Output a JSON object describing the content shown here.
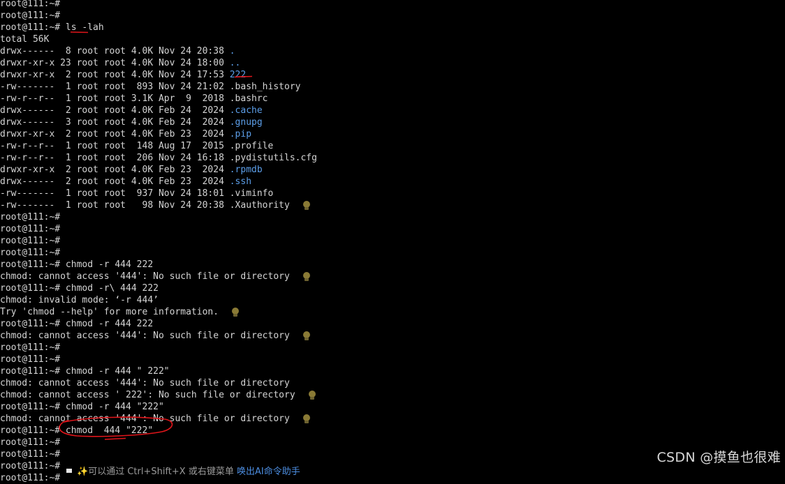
{
  "terminal": {
    "lines": [
      {
        "segments": [
          {
            "t": "root@111:~#"
          }
        ]
      },
      {
        "segments": [
          {
            "t": "root@111:~#"
          }
        ]
      },
      {
        "segments": [
          {
            "t": "root@111:~# ls -lah"
          }
        ]
      },
      {
        "segments": [
          {
            "t": "total 56K"
          }
        ]
      },
      {
        "segments": [
          {
            "t": "drwx------  8 root root 4.0K Nov 24 20:38 "
          },
          {
            "t": ".",
            "cls": "dir"
          }
        ]
      },
      {
        "segments": [
          {
            "t": "drwxr-xr-x 23 root root 4.0K Nov 24 18:00 "
          },
          {
            "t": "..",
            "cls": "dir"
          }
        ]
      },
      {
        "segments": [
          {
            "t": "drwxr-xr-x  2 root root 4.0K Nov 24 17:53 "
          },
          {
            "t": "222",
            "cls": "dir"
          }
        ]
      },
      {
        "segments": [
          {
            "t": "-rw-------  1 root root  893 Nov 24 21:02 .bash_history"
          }
        ]
      },
      {
        "segments": [
          {
            "t": "-rw-r--r--  1 root root 3.1K Apr  9  2018 .bashrc"
          }
        ]
      },
      {
        "segments": [
          {
            "t": "drwx------  2 root root 4.0K Feb 24  2024 "
          },
          {
            "t": ".cache",
            "cls": "dir"
          }
        ]
      },
      {
        "segments": [
          {
            "t": "drwx------  3 root root 4.0K Feb 24  2024 "
          },
          {
            "t": ".gnupg",
            "cls": "dir"
          }
        ]
      },
      {
        "segments": [
          {
            "t": "drwxr-xr-x  2 root root 4.0K Feb 23  2024 "
          },
          {
            "t": ".pip",
            "cls": "dir"
          }
        ]
      },
      {
        "segments": [
          {
            "t": "-rw-r--r--  1 root root  148 Aug 17  2015 .profile"
          }
        ]
      },
      {
        "segments": [
          {
            "t": "-rw-r--r--  1 root root  206 Nov 24 16:18 .pydistutils.cfg"
          }
        ]
      },
      {
        "segments": [
          {
            "t": "drwxr-xr-x  2 root root 4.0K Feb 23  2024 "
          },
          {
            "t": ".rpmdb",
            "cls": "dir"
          }
        ]
      },
      {
        "segments": [
          {
            "t": "drwx------  2 root root 4.0K Feb 23  2024 "
          },
          {
            "t": ".ssh",
            "cls": "dir"
          }
        ]
      },
      {
        "segments": [
          {
            "t": "-rw-------  1 root root  937 Nov 24 18:01 .viminfo"
          }
        ]
      },
      {
        "segments": [
          {
            "t": "-rw-------  1 root root   98 Nov 24 20:38 .Xauthority"
          }
        ],
        "bulb": true
      },
      {
        "segments": [
          {
            "t": "root@111:~#"
          }
        ]
      },
      {
        "segments": [
          {
            "t": "root@111:~#"
          }
        ]
      },
      {
        "segments": [
          {
            "t": "root@111:~#"
          }
        ]
      },
      {
        "segments": [
          {
            "t": "root@111:~#"
          }
        ]
      },
      {
        "segments": [
          {
            "t": "root@111:~# chmod -r 444 222"
          }
        ]
      },
      {
        "segments": [
          {
            "t": "chmod: cannot access '444': No such file or directory"
          }
        ],
        "bulb": true
      },
      {
        "segments": [
          {
            "t": "root@111:~# chmod -r\\ 444 222"
          }
        ]
      },
      {
        "segments": [
          {
            "t": "chmod: invalid mode: ‘-r 444’"
          }
        ]
      },
      {
        "segments": [
          {
            "t": "Try 'chmod --help' for more information."
          }
        ],
        "bulb": true
      },
      {
        "segments": [
          {
            "t": "root@111:~# chmod -r 444 222"
          }
        ]
      },
      {
        "segments": [
          {
            "t": "chmod: cannot access '444': No such file or directory"
          }
        ],
        "bulb": true
      },
      {
        "segments": [
          {
            "t": "root@111:~#"
          }
        ]
      },
      {
        "segments": [
          {
            "t": "root@111:~#"
          }
        ]
      },
      {
        "segments": [
          {
            "t": "root@111:~# chmod -r 444 \" 222\""
          }
        ]
      },
      {
        "segments": [
          {
            "t": "chmod: cannot access '444': No such file or directory"
          }
        ]
      },
      {
        "segments": [
          {
            "t": "chmod: cannot access ' 222': No such file or directory"
          }
        ],
        "bulb": true
      },
      {
        "segments": [
          {
            "t": "root@111:~# chmod -r 444 \"222\""
          }
        ]
      },
      {
        "segments": [
          {
            "t": "chmod: cannot access '444': No such file or directory"
          }
        ],
        "bulb": true
      },
      {
        "segments": [
          {
            "t": "root@111:~# chmod  444 \"222\""
          }
        ]
      },
      {
        "segments": [
          {
            "t": "root@111:~#"
          }
        ]
      },
      {
        "segments": [
          {
            "t": "root@111:~#"
          }
        ]
      },
      {
        "segments": [
          {
            "t": "root@111:~#"
          }
        ]
      },
      {
        "segments": [
          {
            "t": "root@111:~#"
          }
        ]
      }
    ],
    "hint": {
      "sparkle": "✨",
      "text": "可以通过 Ctrl+Shift+X 或右键菜单 ",
      "link": "唤出AI命令助手"
    }
  },
  "watermark": "CSDN @摸鱼也很难",
  "colors": {
    "background": "#000000",
    "text": "#d4d4d4",
    "directory": "#5c9ee8",
    "annotation": "#e0151a",
    "bulb": "#8a7a35"
  },
  "icons": [
    "lightbulb-icon"
  ]
}
